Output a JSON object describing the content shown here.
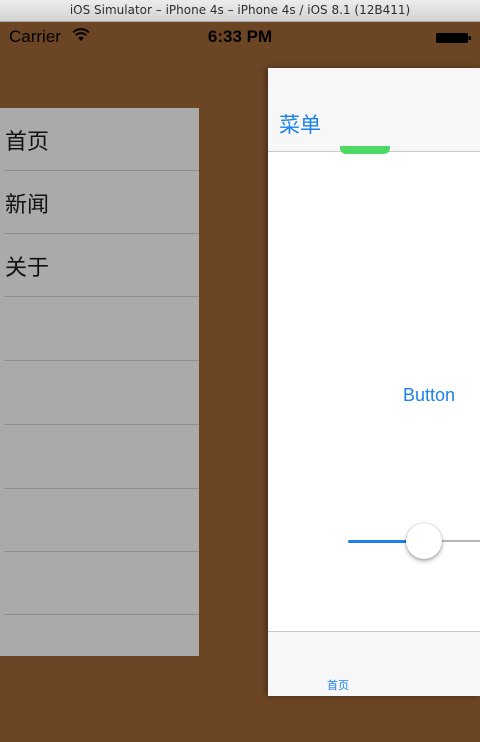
{
  "window": {
    "title": "iOS Simulator – iPhone 4s – iPhone 4s / iOS 8.1 (12B411)"
  },
  "status_bar": {
    "carrier": "Carrier",
    "time": "6:33 PM",
    "wifi_icon": "wifi-icon",
    "battery_icon": "battery-full-icon"
  },
  "menu": {
    "items": [
      {
        "label": "首页"
      },
      {
        "label": "新闻"
      },
      {
        "label": "关于"
      },
      {
        "label": ""
      },
      {
        "label": ""
      },
      {
        "label": ""
      },
      {
        "label": ""
      },
      {
        "label": ""
      },
      {
        "label": ""
      }
    ]
  },
  "main": {
    "nav_menu_label": "菜单",
    "center_button_label": "Button",
    "slider_value": 0.57,
    "tab_bar": {
      "items": [
        {
          "label": "首页",
          "selected": true
        }
      ]
    }
  },
  "colors": {
    "background": "#6b4524",
    "menu_panel": "#aaaaaa",
    "accent": "#1a82e8",
    "switch_on": "#4cd964"
  }
}
